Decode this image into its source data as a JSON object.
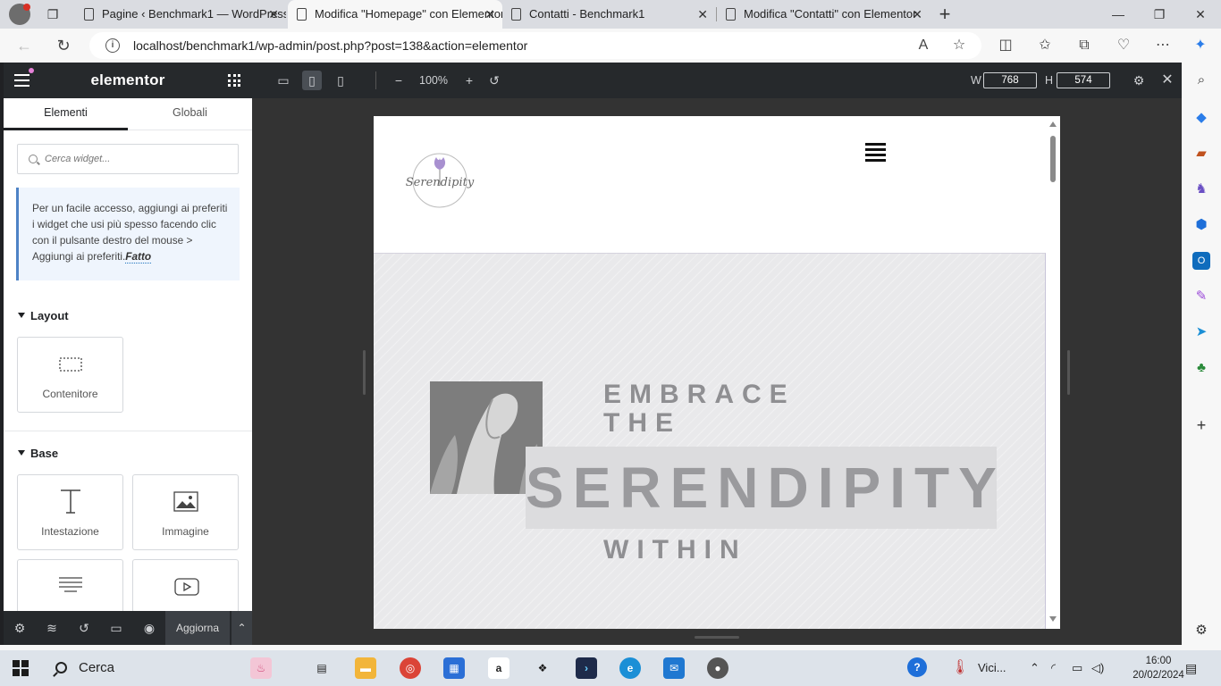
{
  "browser": {
    "tabs": [
      {
        "title": "Pagine ‹ Benchmark1 — WordPress",
        "active": false
      },
      {
        "title": "Modifica \"Homepage\" con Elementor",
        "active": true
      },
      {
        "title": "Contatti - Benchmark1",
        "active": false
      },
      {
        "title": "Modifica \"Contatti\" con Elementor",
        "active": false
      }
    ],
    "url": "localhost/benchmark1/wp-admin/post.php?post=138&action=elementor"
  },
  "panel": {
    "brand": "elementor",
    "tabs": [
      "Elementi",
      "Globali"
    ],
    "search_placeholder": "Cerca widget...",
    "tip_text": "Per un facile accesso, aggiungi ai preferiti i widget che usi più spesso facendo clic con il pulsante destro del mouse > Aggiungi ai preferiti.",
    "tip_done": "Fatto",
    "layout_section": "Layout",
    "layout_widgets": [
      "Contenitore"
    ],
    "base_section": "Base",
    "base_widgets": [
      "Intestazione",
      "Immagine"
    ],
    "footer_button": "Aggiorna"
  },
  "topbar": {
    "zoom": "100%",
    "width_label": "W",
    "width_value": "768",
    "height_label": "H",
    "height_value": "574"
  },
  "preview": {
    "logo_script": "Serendipity",
    "hero_line1": "EMBRACE",
    "hero_line2": "THE",
    "hero_line3": "SERENDIPITY",
    "hero_line4": "WITHIN"
  },
  "taskbar": {
    "search_label": "Cerca",
    "weather_label": "Vici...",
    "time": "16:00",
    "date": "20/02/2024"
  },
  "colors": {
    "elementor_dark": "#26292c",
    "canvas_bg": "#333333",
    "hero_text": "#8f8f92",
    "tip_border": "#4e83c6"
  }
}
